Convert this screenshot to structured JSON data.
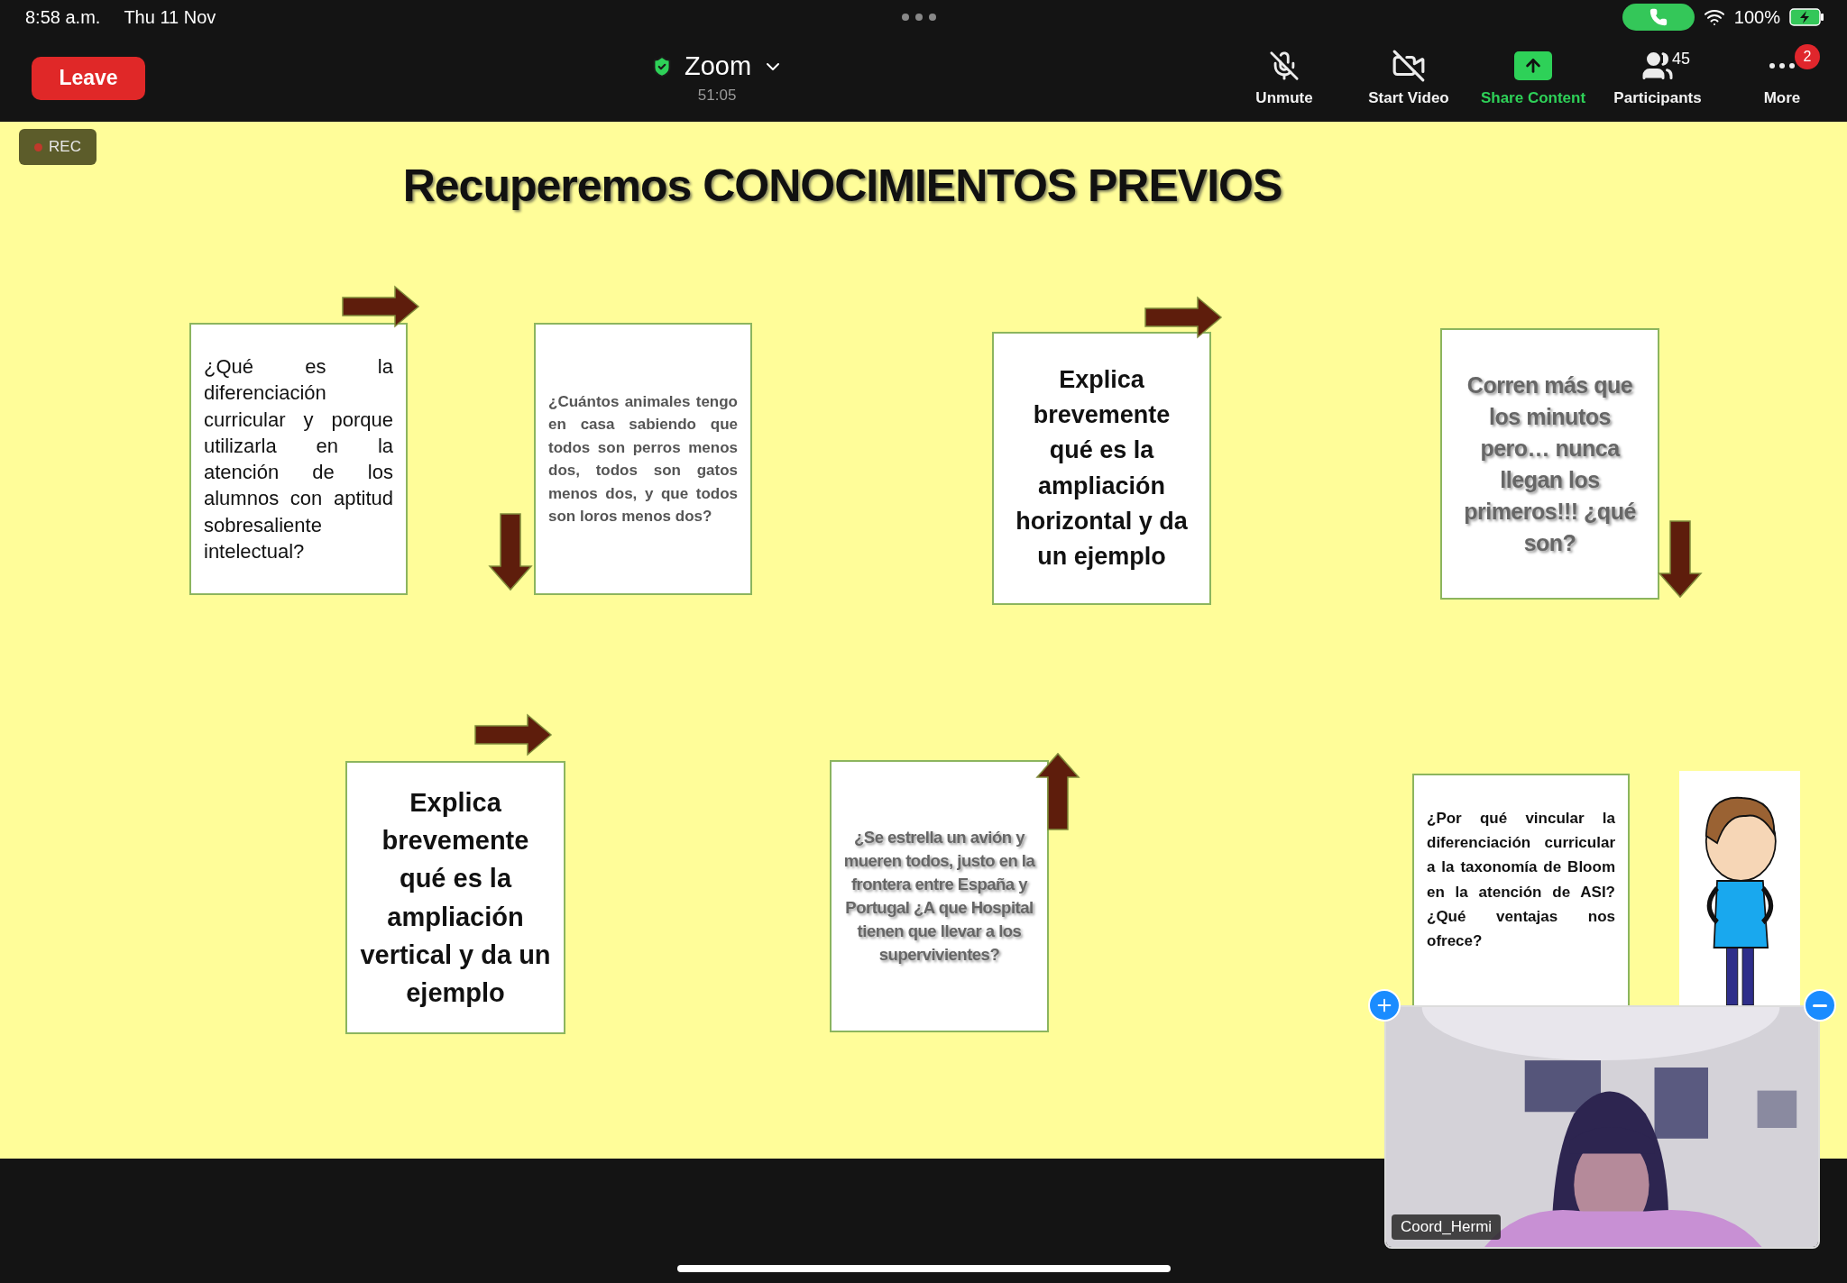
{
  "status_bar": {
    "time": "8:58 a.m.",
    "date": "Thu 11 Nov",
    "battery": "100%"
  },
  "toolbar": {
    "leave": "Leave",
    "meeting_title": "Zoom",
    "timer": "51:05",
    "buttons": [
      {
        "kind": "mic-off",
        "label": "Unmute",
        "highlighted": false
      },
      {
        "kind": "video-off",
        "label": "Start Video",
        "highlighted": false
      },
      {
        "kind": "share",
        "label": "Share Content",
        "highlighted": true
      },
      {
        "kind": "participants",
        "label": "Participants",
        "highlighted": false,
        "count": "45"
      },
      {
        "kind": "more",
        "label": "More",
        "highlighted": false,
        "badge": "2"
      }
    ]
  },
  "recording": {
    "label": "REC"
  },
  "slide": {
    "title": "Recuperemos CONOCIMIENTOS PREVIOS",
    "cards": [
      {
        "kind": "plain",
        "text": "¿Qué es la diferenciación curricular y porque utilizarla en la atención de los alumnos con aptitud sobresaliente intelectual?"
      },
      {
        "kind": "grey",
        "text": "¿Cuántos animales tengo en casa sabiendo que todos son perros menos dos, todos son gatos menos dos, y que todos son loros menos dos?"
      },
      {
        "kind": "bold",
        "text": "Explica brevemente qué es la ampliación horizontal y da un ejemplo"
      },
      {
        "kind": "shadow",
        "text": "Corren más que los minutos pero… nunca llegan los primeros!!! ¿qué son?"
      },
      {
        "kind": "bold",
        "text": "Explica brevemente qué es la ampliación vertical y da un ejemplo"
      },
      {
        "kind": "shadow",
        "text": "¿Se estrella un avión y mueren todos, justo en la frontera entre España y Portugal ¿A que Hospital tienen que llevar a los supervivientes?"
      },
      {
        "kind": "boldjustify",
        "text": "¿Por qué vincular la diferenciación curricular a la taxonomía de Bloom en la atención de ASI? ¿Qué ventajas nos ofrece?"
      }
    ]
  },
  "video": {
    "name": "Coord_Hermi"
  }
}
